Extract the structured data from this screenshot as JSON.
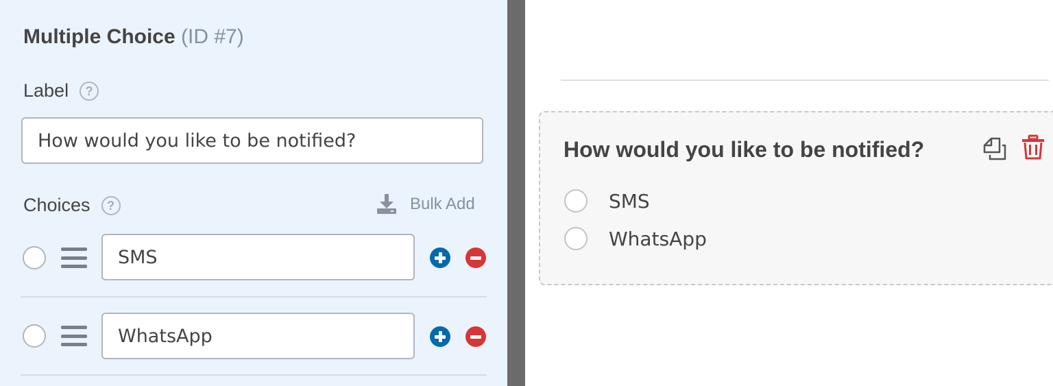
{
  "field_options": {
    "title": "Multiple Choice",
    "field_id": "(ID #7)",
    "label_heading": "Label",
    "label_value": "How would you like to be notified?",
    "choices_heading": "Choices",
    "bulk_add_label": "Bulk Add",
    "choices": [
      {
        "value": "SMS"
      },
      {
        "value": "WhatsApp"
      }
    ],
    "icons": {
      "help": "question-circle-icon",
      "bulk_add": "download-icon",
      "drag": "drag-handle-icon",
      "add": "plus-circle-icon",
      "remove": "minus-circle-icon"
    }
  },
  "preview": {
    "question": "How would you like to be notified?",
    "options": [
      "SMS",
      "WhatsApp"
    ],
    "icons": {
      "duplicate": "duplicate-icon",
      "delete": "trash-icon"
    }
  },
  "colors": {
    "panel_bg": "#ebf3fc",
    "add_button": "#036aab",
    "remove_button": "#d63638",
    "delete_icon": "#d63638",
    "splitter": "#6b6b6b"
  }
}
